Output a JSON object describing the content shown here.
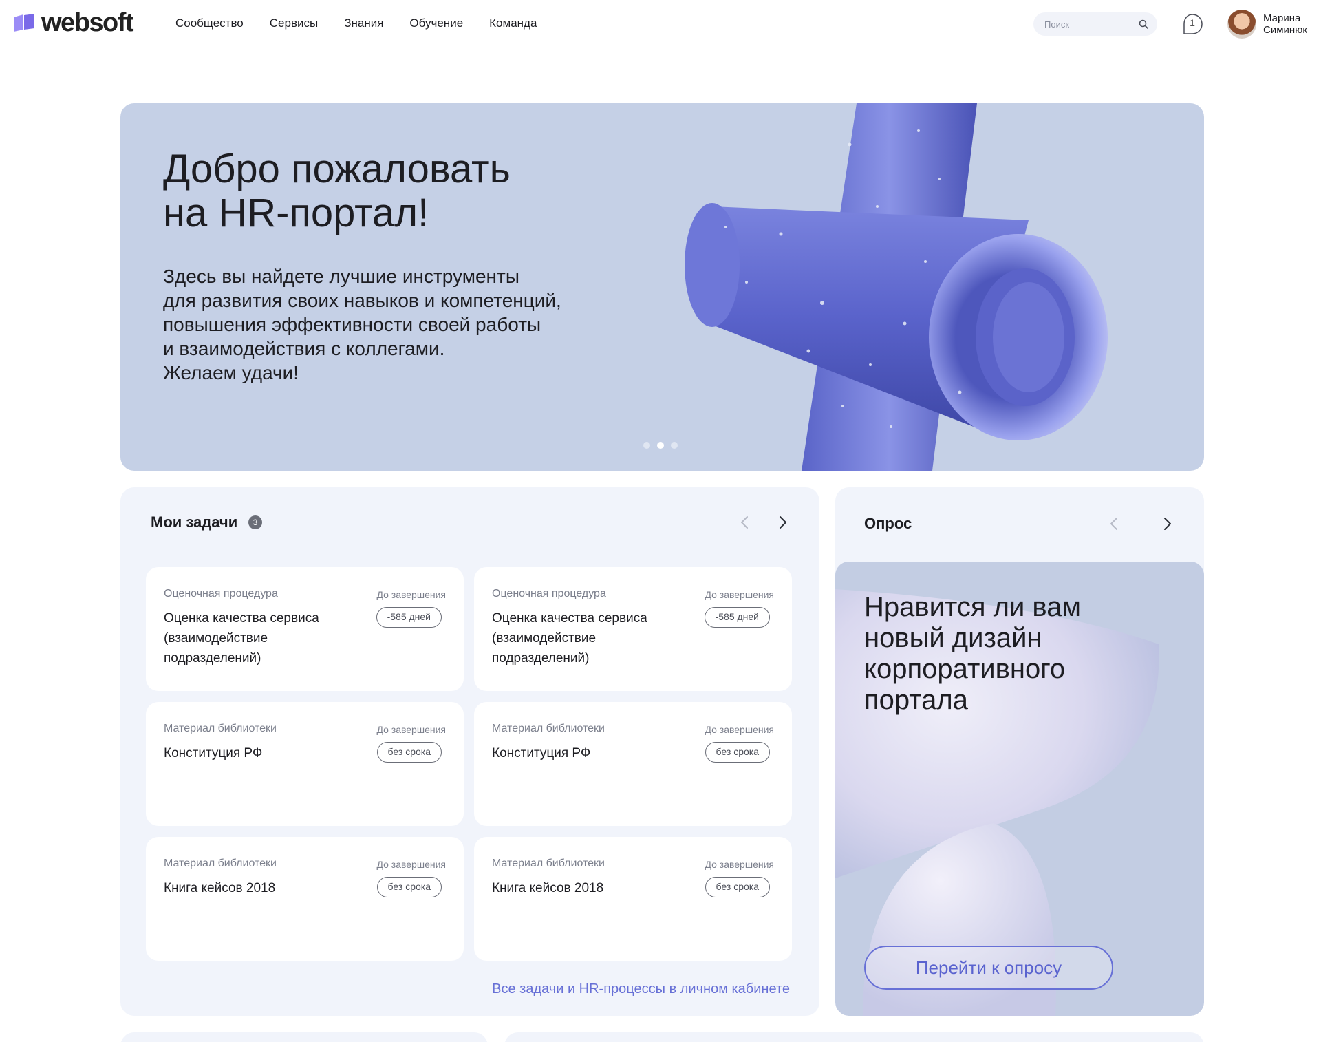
{
  "header": {
    "logo_text": "websoft",
    "nav": [
      "Сообщество",
      "Сервисы",
      "Знания",
      "Обучение",
      "Команда"
    ],
    "search_placeholder": "Поиск",
    "notification_count": "1",
    "user_name_line1": "Марина",
    "user_name_line2": "Симинюк"
  },
  "hero": {
    "title_line1": "Добро пожаловать",
    "title_line2": "на HR-портал!",
    "text_lines": [
      "Здесь вы найдете лучшие инструменты",
      "для развития своих навыков и компетенций,",
      "повышения эффективности своей работы",
      "и взаимодействия с коллегами.",
      "Желаем удачи!"
    ],
    "slides_total": 3,
    "slide_active": 2
  },
  "tasks": {
    "title": "Мои задачи",
    "count": "3",
    "cards": [
      {
        "type": "Оценочная процедура",
        "deadline_label": "До завершения",
        "name": "Оценка качества сервиса (взаимодействие подразделений)",
        "deadline": "-585 дней"
      },
      {
        "type": "Оценочная процедура",
        "deadline_label": "До завершения",
        "name": "Оценка качества сервиса (взаимодействие подразделений)",
        "deadline": "-585 дней"
      },
      {
        "type": "Материал библиотеки",
        "deadline_label": "До завершения",
        "name": "Конституция РФ",
        "deadline": "без срока"
      },
      {
        "type": "Материал библиотеки",
        "deadline_label": "До завершения",
        "name": "Конституция РФ",
        "deadline": "без срока"
      },
      {
        "type": "Материал библиотеки",
        "deadline_label": "До завершения",
        "name": "Книга кейсов 2018",
        "deadline": "без срока"
      },
      {
        "type": "Материал библиотеки",
        "deadline_label": "До завершения",
        "name": "Книга кейсов 2018",
        "deadline": "без срока"
      }
    ],
    "all_link": "Все задачи и HR-процессы в личном кабинете"
  },
  "survey": {
    "title": "Опрос",
    "question": "Нравится ли вам новый дизайн корпоративного портала",
    "button": "Перейти к опросу"
  },
  "colors": {
    "accent": "#6770d6",
    "hero_bg": "#c5d0e6",
    "panel_bg": "#f1f4fb",
    "logo": "#8b7cf0"
  },
  "icons": [
    "logo-mark-icon",
    "search-icon",
    "notification-bell-icon",
    "chevron-left-icon",
    "chevron-right-icon"
  ]
}
